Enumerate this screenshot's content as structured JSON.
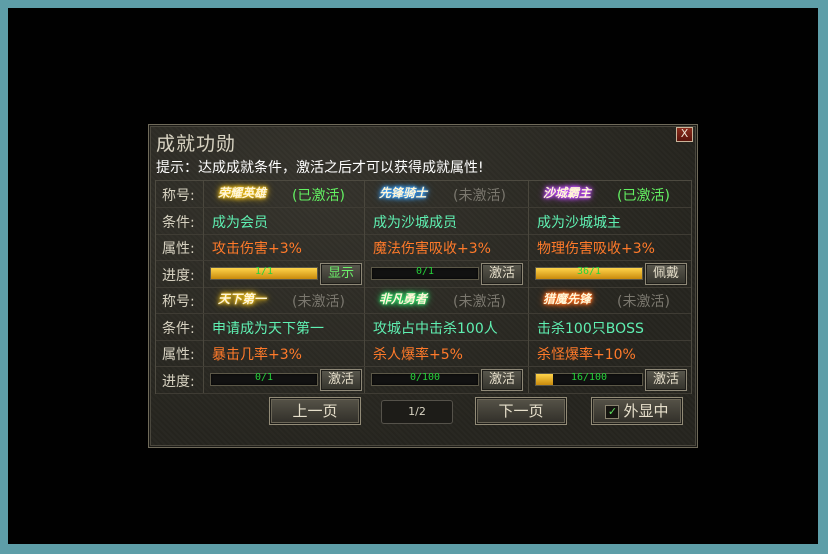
{
  "dialog": {
    "title": "成就功勋",
    "hint": "提示：达成成就条件，激活之后才可以获得成就属性!",
    "close_label": "X"
  },
  "row_labels": {
    "title": "称号:",
    "condition": "条件:",
    "attribute": "属性:",
    "progress": "进度:"
  },
  "groups": [
    {
      "cells": [
        {
          "title": "荣耀英雄",
          "title_color": "#f3c21a",
          "status": "(已激活)",
          "active": true,
          "condition": "成为会员",
          "attribute": "攻击伤害+3%",
          "progress_text": "1/1",
          "progress": 1.0,
          "button": "显示",
          "button_green": true
        },
        {
          "title": "先锋骑士",
          "title_color": "#3aa2ff",
          "status": "(未激活)",
          "active": false,
          "condition": "成为沙城成员",
          "attribute": "魔法伤害吸收+3%",
          "progress_text": "0/1",
          "progress": 0.0,
          "button": "激活",
          "button_green": false
        },
        {
          "title": "沙城霸主",
          "title_color": "#c04cff",
          "status": "(已激活)",
          "active": true,
          "condition": "成为沙城城主",
          "attribute": "物理伤害吸收+3%",
          "progress_text": "36/1",
          "progress": 1.0,
          "button": "佩戴",
          "button_green": false
        }
      ]
    },
    {
      "cells": [
        {
          "title": "天下第一",
          "title_color": "#f3c21a",
          "status": "(未激活)",
          "active": false,
          "condition": "申请成为天下第一",
          "attribute": "暴击几率+3%",
          "progress_text": "0/1",
          "progress": 0.0,
          "button": "激活",
          "button_green": false
        },
        {
          "title": "非凡勇者",
          "title_color": "#2fe06a",
          "status": "(未激活)",
          "active": false,
          "condition": "攻城占中击杀100人",
          "attribute": "杀人爆率+5%",
          "progress_text": "0/100",
          "progress": 0.0,
          "button": "激活",
          "button_green": false
        },
        {
          "title": "猎魔先锋",
          "title_color": "#ff6a1a",
          "status": "(未激活)",
          "active": false,
          "condition": "击杀100只BOSS",
          "attribute": "杀怪爆率+10%",
          "progress_text": "16/100",
          "progress": 0.16,
          "button": "激活",
          "button_green": false
        }
      ]
    }
  ],
  "pagination": {
    "prev": "上一页",
    "page": "1/2",
    "next": "下一页",
    "show_outside": "外显中",
    "show_outside_checked": true,
    "check_mark": "✓"
  }
}
